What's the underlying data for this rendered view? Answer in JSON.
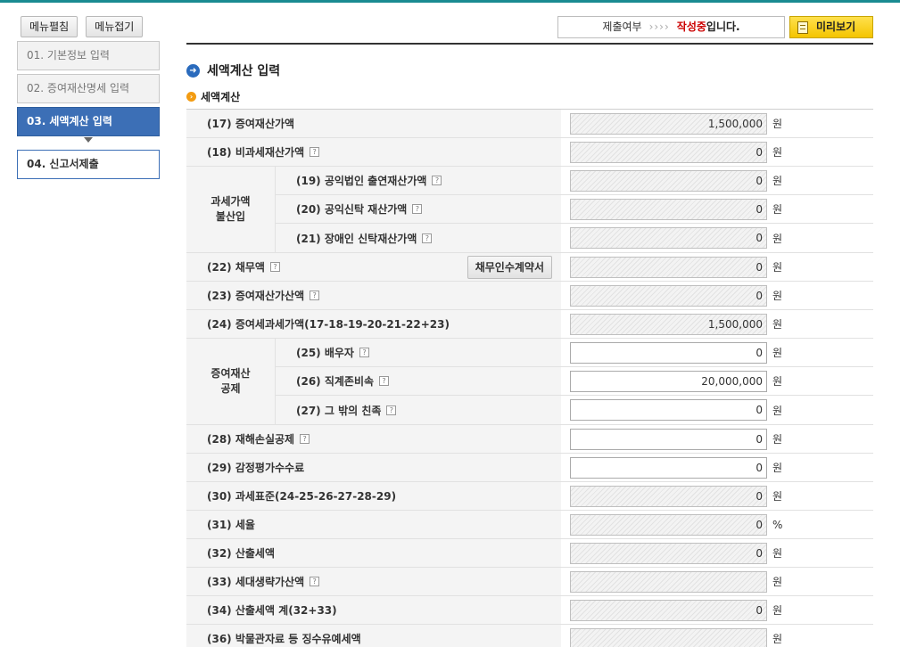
{
  "menu": {
    "expand_label": "메뉴펼침",
    "collapse_label": "메뉴접기"
  },
  "steps": [
    {
      "label": "01. 기본정보 입력",
      "state": "done"
    },
    {
      "label": "02. 증여재산명세 입력",
      "state": "done"
    },
    {
      "label": "03. 세액계산 입력",
      "state": "active"
    },
    {
      "label": "04. 신고서제출",
      "state": "next"
    }
  ],
  "status": {
    "label": "제출여부",
    "arrows": "››››",
    "value": "작성중",
    "suffix": "입니다."
  },
  "preview_label": "미리보기",
  "section_title": "세액계산 입력",
  "sub_title": "세액계산",
  "debt_button_label": "채무인수계약서",
  "groups": {
    "exclusion": "과세가액\n불산입",
    "deduction": "증여재산\n공제"
  },
  "rows": {
    "r17": {
      "label": "(17) 증여재산가액",
      "value": "1,500,000",
      "unit": "원"
    },
    "r18": {
      "label": "(18) 비과세재산가액",
      "value": "0",
      "unit": "원"
    },
    "r19": {
      "label": "(19) 공익법인 출연재산가액",
      "value": "0",
      "unit": "원"
    },
    "r20": {
      "label": "(20) 공익신탁 재산가액",
      "value": "0",
      "unit": "원"
    },
    "r21": {
      "label": "(21) 장애인 신탁재산가액",
      "value": "0",
      "unit": "원"
    },
    "r22": {
      "label": "(22) 채무액",
      "value": "0",
      "unit": "원"
    },
    "r23": {
      "label": "(23) 증여재산가산액",
      "value": "0",
      "unit": "원"
    },
    "r24": {
      "label": "(24) 증여세과세가액(17-18-19-20-21-22+23)",
      "value": "1,500,000",
      "unit": "원"
    },
    "r25": {
      "label": "(25) 배우자",
      "value": "0",
      "unit": "원"
    },
    "r26": {
      "label": "(26) 직계존비속",
      "value": "20,000,000",
      "unit": "원"
    },
    "r27": {
      "label": "(27) 그 밖의 친족",
      "value": "0",
      "unit": "원"
    },
    "r28": {
      "label": "(28) 재해손실공제",
      "value": "0",
      "unit": "원"
    },
    "r29": {
      "label": "(29) 감정평가수수료",
      "value": "0",
      "unit": "원"
    },
    "r30": {
      "label": "(30) 과세표준(24-25-26-27-28-29)",
      "value": "0",
      "unit": "원"
    },
    "r31": {
      "label": "(31) 세율",
      "value": "0",
      "unit": "%"
    },
    "r32": {
      "label": "(32) 산출세액",
      "value": "0",
      "unit": "원"
    },
    "r33": {
      "label": "(33) 세대생략가산액",
      "value": "",
      "unit": "원"
    },
    "r34": {
      "label": "(34) 산출세액 계(32+33)",
      "value": "0",
      "unit": "원"
    },
    "r36": {
      "label": "(36) 박물관자료 등 징수유예세액",
      "value": "",
      "unit": "원"
    }
  }
}
